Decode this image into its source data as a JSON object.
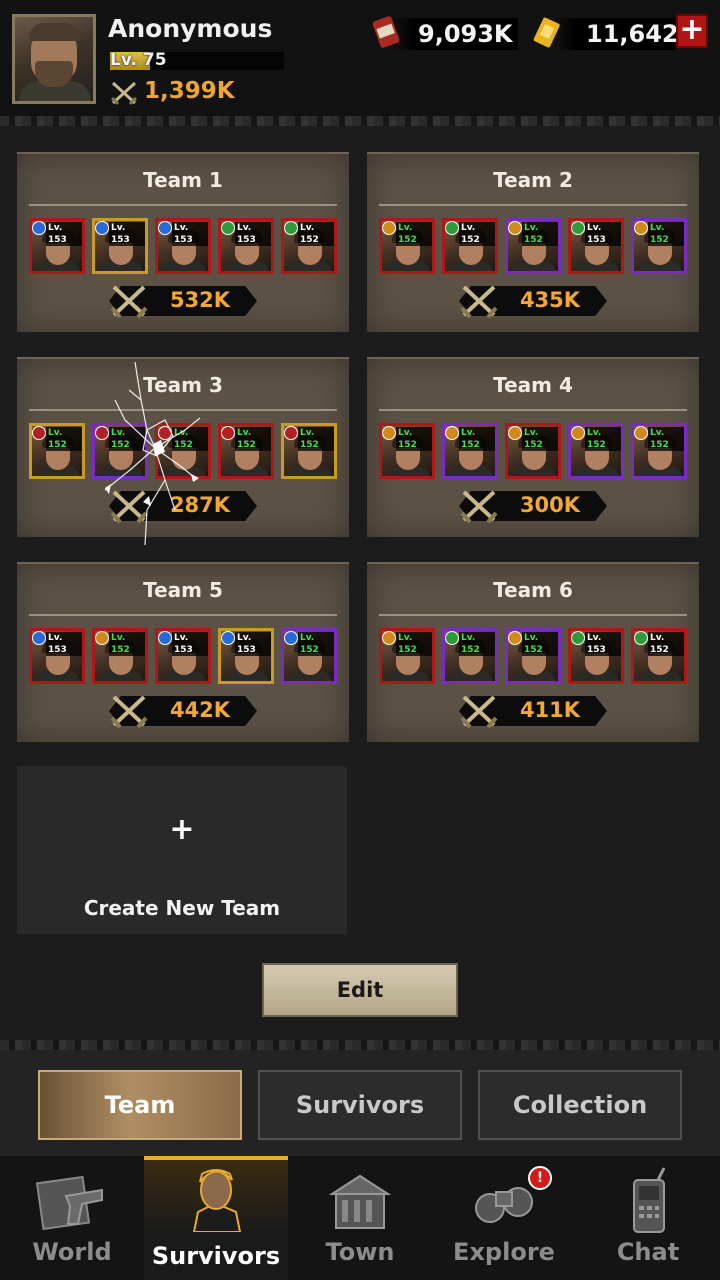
{
  "player": {
    "name": "Anonymous",
    "level": "Lv. 75",
    "level_progress": 0.23,
    "power": "1,399K"
  },
  "resources": {
    "supplies": "9,093K",
    "gold": "11,642"
  },
  "teams": [
    {
      "title": "Team 1",
      "power": "532K",
      "heroes": [
        {
          "level": "Lv. 153",
          "badge": "blue",
          "frame": "red",
          "green": false
        },
        {
          "level": "Lv. 153",
          "badge": "blue",
          "frame": "gold",
          "green": false
        },
        {
          "level": "Lv. 153",
          "badge": "blue",
          "frame": "red",
          "green": false
        },
        {
          "level": "Lv. 153",
          "badge": "green",
          "frame": "red",
          "green": false
        },
        {
          "level": "Lv. 152",
          "badge": "green",
          "frame": "red",
          "green": false
        }
      ]
    },
    {
      "title": "Team 2",
      "power": "435K",
      "heroes": [
        {
          "level": "Lv. 152",
          "badge": "orange",
          "frame": "red",
          "green": true
        },
        {
          "level": "Lv. 152",
          "badge": "green",
          "frame": "red",
          "green": false
        },
        {
          "level": "Lv. 152",
          "badge": "orange",
          "frame": "purple",
          "green": true
        },
        {
          "level": "Lv. 153",
          "badge": "green",
          "frame": "red",
          "green": false
        },
        {
          "level": "Lv. 152",
          "badge": "orange",
          "frame": "purple",
          "green": true
        }
      ]
    },
    {
      "title": "Team 3",
      "power": "287K",
      "heroes": [
        {
          "level": "Lv. 152",
          "badge": "red",
          "frame": "gold",
          "green": true
        },
        {
          "level": "Lv. 152",
          "badge": "red",
          "frame": "purple",
          "green": true
        },
        {
          "level": "Lv. 152",
          "badge": "red",
          "frame": "red",
          "green": true
        },
        {
          "level": "Lv. 152",
          "badge": "red",
          "frame": "red",
          "green": true
        },
        {
          "level": "Lv. 152",
          "badge": "red",
          "frame": "gold",
          "green": true
        }
      ]
    },
    {
      "title": "Team 4",
      "power": "300K",
      "heroes": [
        {
          "level": "Lv. 152",
          "badge": "orange",
          "frame": "red",
          "green": true
        },
        {
          "level": "Lv. 152",
          "badge": "orange",
          "frame": "purple",
          "green": true
        },
        {
          "level": "Lv. 152",
          "badge": "orange",
          "frame": "red",
          "green": true
        },
        {
          "level": "Lv. 152",
          "badge": "orange",
          "frame": "purple",
          "green": true
        },
        {
          "level": "Lv. 152",
          "badge": "orange",
          "frame": "purple",
          "green": true
        }
      ]
    },
    {
      "title": "Team 5",
      "power": "442K",
      "heroes": [
        {
          "level": "Lv. 153",
          "badge": "blue",
          "frame": "red",
          "green": false
        },
        {
          "level": "Lv. 152",
          "badge": "orange",
          "frame": "red",
          "green": true
        },
        {
          "level": "Lv. 153",
          "badge": "blue",
          "frame": "red",
          "green": false
        },
        {
          "level": "Lv. 153",
          "badge": "blue",
          "frame": "gold",
          "green": false
        },
        {
          "level": "Lv. 152",
          "badge": "blue",
          "frame": "purple",
          "green": true
        }
      ]
    },
    {
      "title": "Team 6",
      "power": "411K",
      "heroes": [
        {
          "level": "Lv. 152",
          "badge": "orange",
          "frame": "red",
          "green": true
        },
        {
          "level": "Lv. 152",
          "badge": "green",
          "frame": "purple",
          "green": true
        },
        {
          "level": "Lv. 152",
          "badge": "orange",
          "frame": "purple",
          "green": true
        },
        {
          "level": "Lv. 153",
          "badge": "green",
          "frame": "red",
          "green": false
        },
        {
          "level": "Lv. 152",
          "badge": "green",
          "frame": "red",
          "green": false
        }
      ]
    }
  ],
  "create_team": {
    "label": "Create New Team",
    "plus": "+"
  },
  "edit_label": "Edit",
  "subtabs": [
    {
      "label": "Team",
      "active": true
    },
    {
      "label": "Survivors",
      "active": false
    },
    {
      "label": "Collection",
      "active": false
    }
  ],
  "nav": [
    {
      "label": "World",
      "icon": "world-icon",
      "active": false
    },
    {
      "label": "Survivors",
      "icon": "survivors-icon",
      "active": true
    },
    {
      "label": "Town",
      "icon": "town-icon",
      "active": false
    },
    {
      "label": "Explore",
      "icon": "explore-icon",
      "active": false
    },
    {
      "label": "Chat",
      "icon": "chat-icon",
      "active": false
    }
  ],
  "explore_alert": "!",
  "colors": {
    "accent_gold": "#f3a836",
    "frame_red": "#b01818",
    "frame_gold": "#c89a28",
    "frame_purple": "#7a2cc2"
  }
}
